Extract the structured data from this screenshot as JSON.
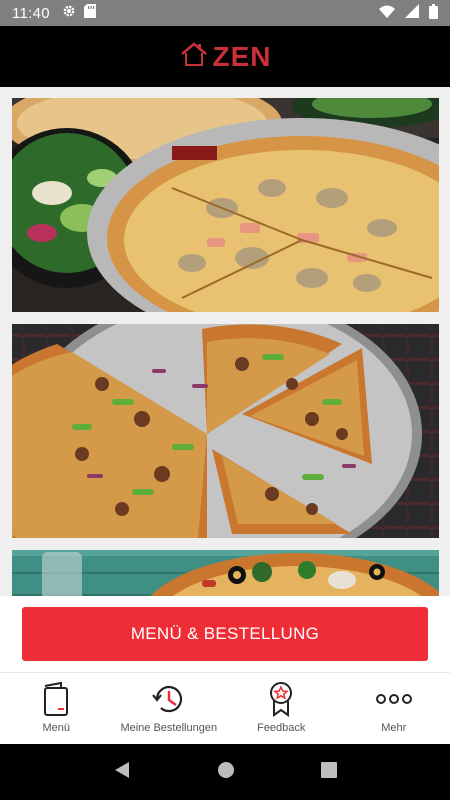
{
  "status_bar": {
    "time": "11:40",
    "icons_left": [
      "gear-icon",
      "sd-card-icon"
    ],
    "icons_right": [
      "wifi-icon",
      "signal-icon",
      "battery-icon"
    ]
  },
  "header": {
    "logo_text": "ZEN",
    "logo_icon": "house-icon",
    "brand_color": "#c9303a"
  },
  "feed": {
    "items": [
      {
        "image": "pizza-ham-mushroom-photo"
      },
      {
        "image": "pizza-beef-pepper-photo"
      },
      {
        "image": "pizza-olive-broccoli-photo"
      }
    ]
  },
  "cta": {
    "label": "MENÜ & BESTELLUNG",
    "color": "#ee2d37"
  },
  "tabs": [
    {
      "label": "Menü",
      "icon": "menu-book-icon"
    },
    {
      "label": "Meine Bestellungen",
      "icon": "history-clock-icon"
    },
    {
      "label": "Feedback",
      "icon": "award-star-icon"
    },
    {
      "label": "Mehr",
      "icon": "more-dots-icon"
    }
  ],
  "system_nav": {
    "icons": [
      "back-icon",
      "home-icon",
      "recents-icon"
    ]
  }
}
